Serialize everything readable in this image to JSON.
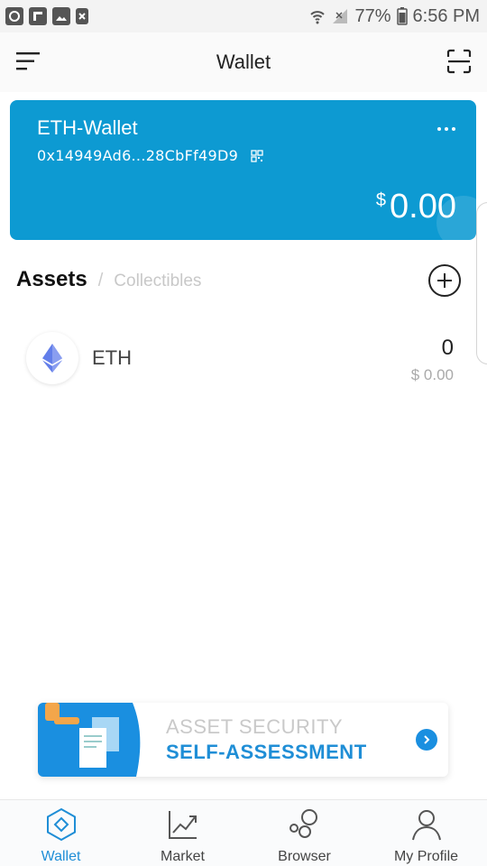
{
  "status_bar": {
    "battery": "77%",
    "time": "6:56 PM",
    "notification_icons": [
      "photos-icon",
      "flipboard-icon",
      "image-icon",
      "close-box-icon"
    ]
  },
  "header": {
    "title": "Wallet"
  },
  "wallet_card": {
    "name": "ETH-Wallet",
    "address": "0x14949Ad6...28CbFf49D9",
    "currency_symbol": "$",
    "balance": "0.00",
    "color": "#0d9ad2"
  },
  "assets": {
    "tab_assets": "Assets",
    "tab_separator": "/",
    "tab_collectibles": "Collectibles",
    "items": [
      {
        "symbol": "ETH",
        "quantity": "0",
        "fiat": "$ 0.00",
        "icon": "ethereum-icon"
      }
    ]
  },
  "banner": {
    "line1": "ASSET SECURITY",
    "line2": "SELF-ASSESSMENT",
    "accent": "#1f8ed6"
  },
  "bottom_nav": {
    "items": [
      {
        "label": "Wallet",
        "icon": "wallet-icon",
        "active": true
      },
      {
        "label": "Market",
        "icon": "chart-icon",
        "active": false
      },
      {
        "label": "Browser",
        "icon": "browser-icon",
        "active": false
      },
      {
        "label": "My Profile",
        "icon": "profile-icon",
        "active": false
      }
    ]
  }
}
